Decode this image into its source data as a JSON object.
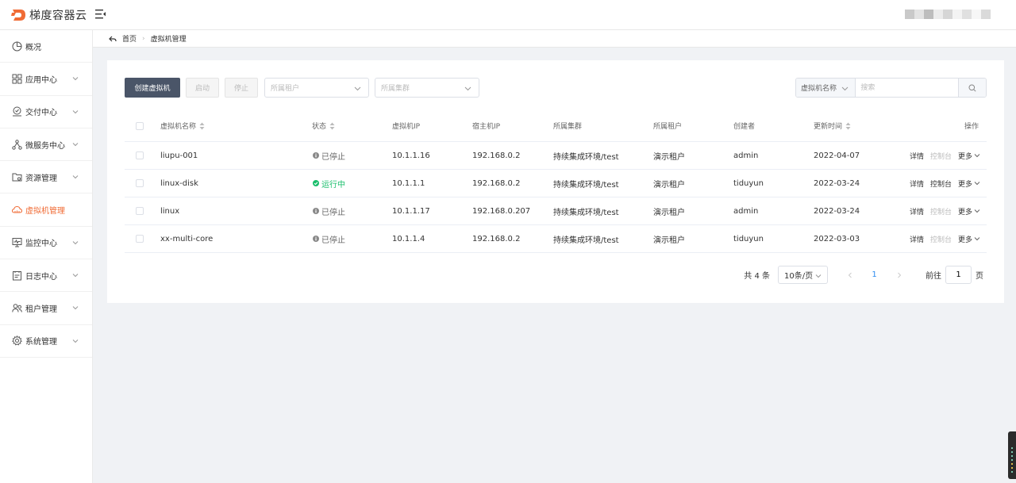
{
  "app": {
    "logo_text": "梯度容器云"
  },
  "sidebar": {
    "items": [
      {
        "label": "概况",
        "icon": "dashboard-icon",
        "has_children": false,
        "active": false
      },
      {
        "label": "应用中心",
        "icon": "apps-grid-icon",
        "has_children": true,
        "active": false
      },
      {
        "label": "交付中心",
        "icon": "delivery-icon",
        "has_children": true,
        "active": false
      },
      {
        "label": "微服务中心",
        "icon": "microservice-icon",
        "has_children": true,
        "active": false
      },
      {
        "label": "资源管理",
        "icon": "resource-icon",
        "has_children": true,
        "active": false
      },
      {
        "label": "虚拟机管理",
        "icon": "cloud-vm-icon",
        "has_children": false,
        "active": true
      },
      {
        "label": "监控中心",
        "icon": "monitor-icon",
        "has_children": true,
        "active": false
      },
      {
        "label": "日志中心",
        "icon": "log-icon",
        "has_children": true,
        "active": false
      },
      {
        "label": "租户管理",
        "icon": "tenant-icon",
        "has_children": true,
        "active": false
      },
      {
        "label": "系统管理",
        "icon": "settings-gear-icon",
        "has_children": true,
        "active": false
      }
    ]
  },
  "breadcrumb": {
    "home": "首页",
    "current": "虚拟机管理"
  },
  "toolbar": {
    "create_label": "创建虚拟机",
    "start_label": "启动",
    "stop_label": "停止",
    "tenant_placeholder": "所属租户",
    "cluster_placeholder": "所属集群",
    "search_type": "虚拟机名称",
    "search_placeholder": "搜索"
  },
  "table": {
    "headers": {
      "name": "虚拟机名称",
      "status": "状态",
      "vm_ip": "虚拟机IP",
      "host_ip": "宿主机IP",
      "cluster": "所属集群",
      "tenant": "所属租户",
      "creator": "创建者",
      "updated": "更新时间",
      "actions": "操作"
    },
    "rows": [
      {
        "name": "liupu-001",
        "status": "已停止",
        "vm_ip": "10.1.1.16",
        "host_ip": "192.168.0.2",
        "cluster": "持续集成环境/test",
        "tenant": "演示租户",
        "creator": "admin",
        "updated": "2022-04-07",
        "detail": "详情",
        "console": "控制台",
        "more": "更多"
      },
      {
        "name": "linux-disk",
        "status": "运行中",
        "vm_ip": "10.1.1.1",
        "host_ip": "192.168.0.2",
        "cluster": "持续集成环境/test",
        "tenant": "演示租户",
        "creator": "tiduyun",
        "updated": "2022-03-24",
        "detail": "详情",
        "console": "控制台",
        "more": "更多"
      },
      {
        "name": "linux",
        "status": "已停止",
        "vm_ip": "10.1.1.17",
        "host_ip": "192.168.0.207",
        "cluster": "持续集成环境/test",
        "tenant": "演示租户",
        "creator": "admin",
        "updated": "2022-03-24",
        "detail": "详情",
        "console": "控制台",
        "more": "更多"
      },
      {
        "name": "xx-multi-core",
        "status": "已停止",
        "vm_ip": "10.1.1.4",
        "host_ip": "192.168.0.2",
        "cluster": "持续集成环境/test",
        "tenant": "演示租户",
        "creator": "tiduyun",
        "updated": "2022-03-03",
        "detail": "详情",
        "console": "控制台",
        "more": "更多"
      }
    ]
  },
  "pagination": {
    "total": "共 4 条",
    "page_size": "10条/页",
    "current_page": "1",
    "goto_prefix": "前往",
    "goto_value": "1",
    "goto_suffix": "页"
  },
  "colors": {
    "brand": "#f06b35",
    "primary_button": "#4a5568",
    "running": "#19be6b",
    "stopped": "#888888",
    "page_active": "#2d8cf0"
  }
}
